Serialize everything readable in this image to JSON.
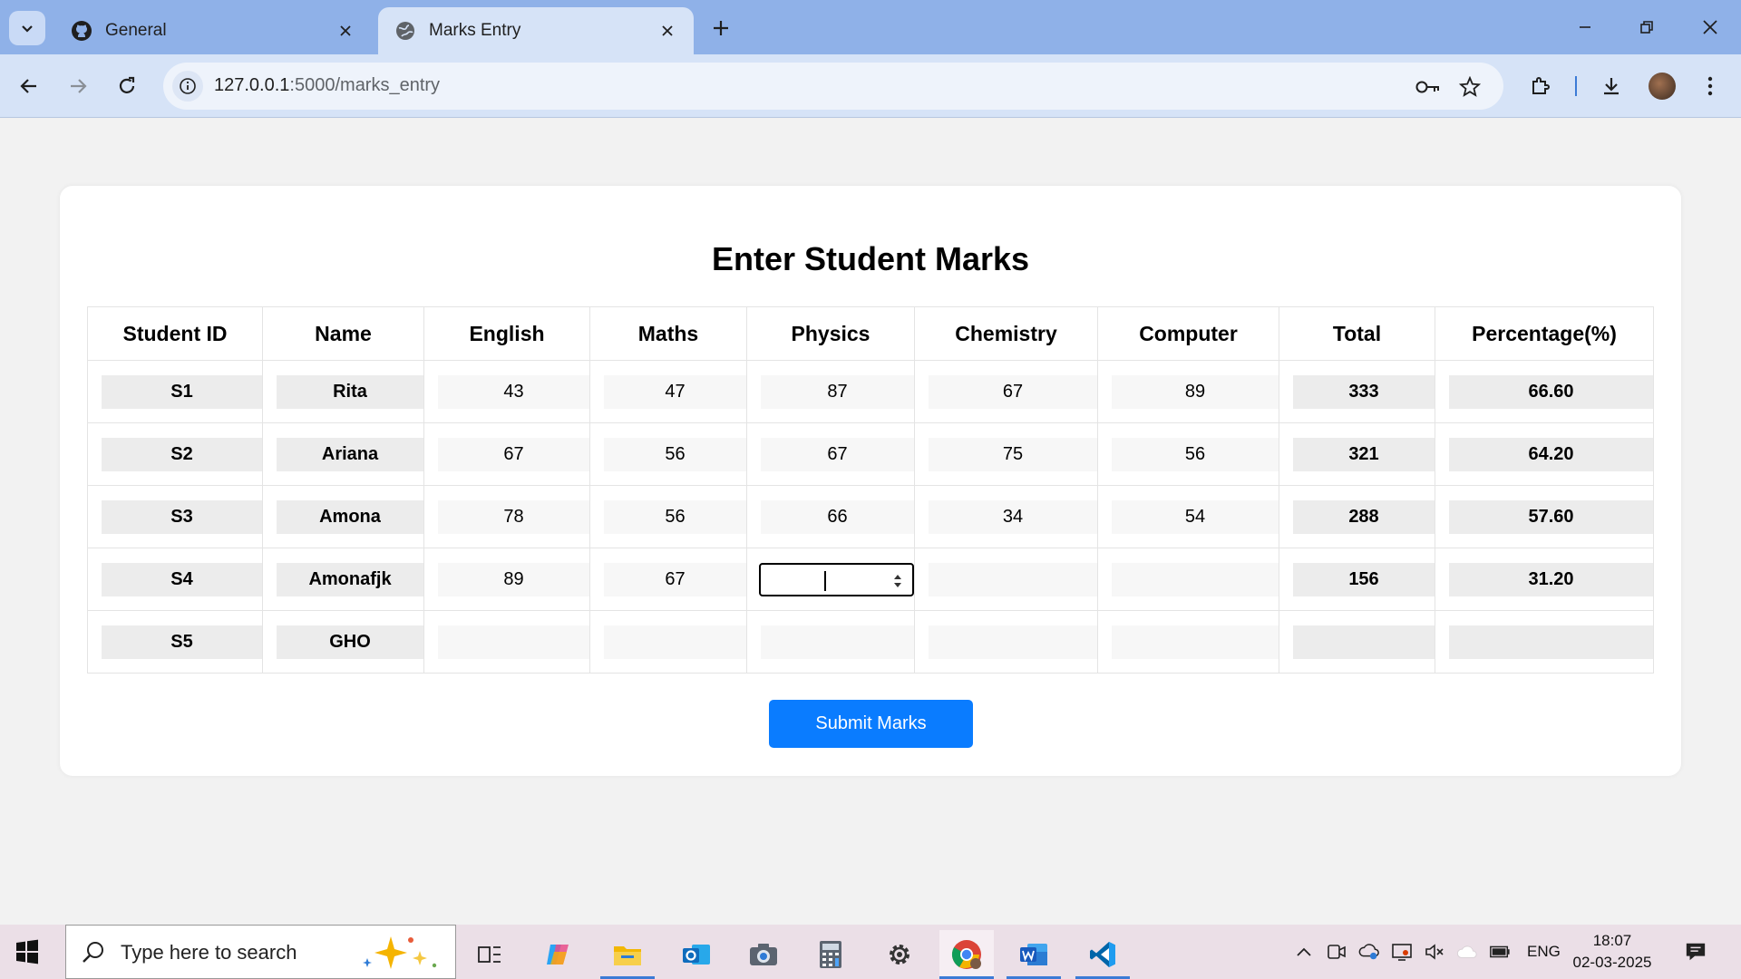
{
  "browser": {
    "tabs": [
      {
        "title": "General",
        "icon": "github-icon",
        "active": false
      },
      {
        "title": "Marks Entry",
        "icon": "globe-icon",
        "active": true
      }
    ],
    "url_host": "127.0.0.1",
    "url_path": ":5000/marks_entry"
  },
  "page": {
    "title": "Enter Student Marks",
    "columns": [
      "Student ID",
      "Name",
      "English",
      "Maths",
      "Physics",
      "Chemistry",
      "Computer",
      "Total",
      "Percentage(%)"
    ],
    "rows": [
      {
        "id": "S1",
        "name": "Rita",
        "english": "43",
        "maths": "47",
        "physics": "87",
        "chemistry": "67",
        "computer": "89",
        "total": "333",
        "percentage": "66.60"
      },
      {
        "id": "S2",
        "name": "Ariana",
        "english": "67",
        "maths": "56",
        "physics": "67",
        "chemistry": "75",
        "computer": "56",
        "total": "321",
        "percentage": "64.20"
      },
      {
        "id": "S3",
        "name": "Amona",
        "english": "78",
        "maths": "56",
        "physics": "66",
        "chemistry": "34",
        "computer": "54",
        "total": "288",
        "percentage": "57.60"
      },
      {
        "id": "S4",
        "name": "Amonafjk",
        "english": "89",
        "maths": "67",
        "physics": "",
        "chemistry": "",
        "computer": "",
        "total": "156",
        "percentage": "31.20"
      },
      {
        "id": "S5",
        "name": "GHO",
        "english": "",
        "maths": "",
        "physics": "",
        "chemistry": "",
        "computer": "",
        "total": "",
        "percentage": ""
      }
    ],
    "submit_label": "Submit Marks",
    "accent_color": "#0a7cff"
  },
  "taskbar": {
    "search_placeholder": "Type here to search",
    "language": "ENG",
    "time": "18:07",
    "date": "02-03-2025",
    "apps": [
      "task-view-icon",
      "copilot-icon",
      "file-explorer-icon",
      "outlook-icon",
      "camera-icon",
      "calculator-icon",
      "settings-icon",
      "chrome-icon",
      "word-icon",
      "vscode-icon"
    ]
  }
}
